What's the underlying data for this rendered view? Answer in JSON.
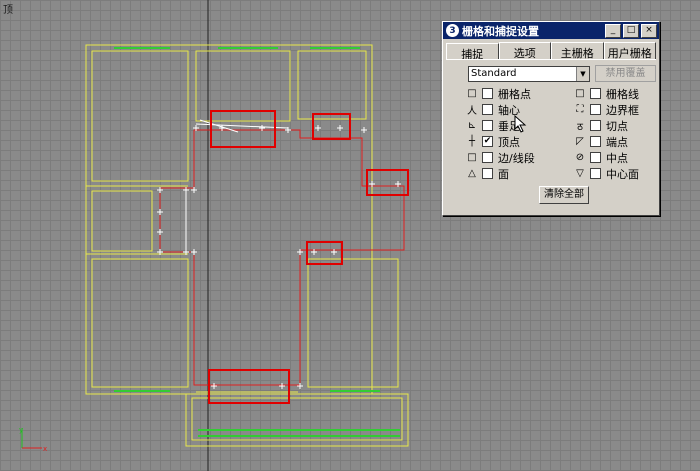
{
  "viewport": {
    "label": "顶"
  },
  "dialog": {
    "title": "栅格和捕捉设置",
    "window_buttons": [
      "_",
      "□",
      "×"
    ],
    "tabs": [
      "捕捉",
      "选项",
      "主栅格",
      "用户栅格"
    ],
    "active_tab": "捕捉",
    "combo_value": "Standard",
    "override_button": "禁用覆盖",
    "clear_button": "清除全部",
    "options_left": [
      {
        "label": "栅格点",
        "checked": false,
        "icon": "grid-point-icon"
      },
      {
        "label": "轴心",
        "checked": false,
        "icon": "pivot-icon"
      },
      {
        "label": "垂足",
        "checked": false,
        "icon": "perpendicular-icon"
      },
      {
        "label": "顶点",
        "checked": true,
        "icon": "vertex-icon"
      },
      {
        "label": "边/线段",
        "checked": false,
        "icon": "edge-icon"
      },
      {
        "label": "面",
        "checked": false,
        "icon": "face-icon"
      }
    ],
    "options_right": [
      {
        "label": "栅格线",
        "checked": false,
        "icon": "grid-line-icon"
      },
      {
        "label": "边界框",
        "checked": false,
        "icon": "bounding-box-icon"
      },
      {
        "label": "切点",
        "checked": false,
        "icon": "tangent-icon"
      },
      {
        "label": "端点",
        "checked": false,
        "icon": "endpoint-icon"
      },
      {
        "label": "中点",
        "checked": false,
        "icon": "midpoint-icon"
      },
      {
        "label": "中心面",
        "checked": false,
        "icon": "center-face-icon"
      }
    ]
  },
  "colors": {
    "walls": "#e8e84a",
    "windows": "#33cc33",
    "outline": "#e02020",
    "highlight": "#e00000",
    "vertex": "#ffffff"
  }
}
